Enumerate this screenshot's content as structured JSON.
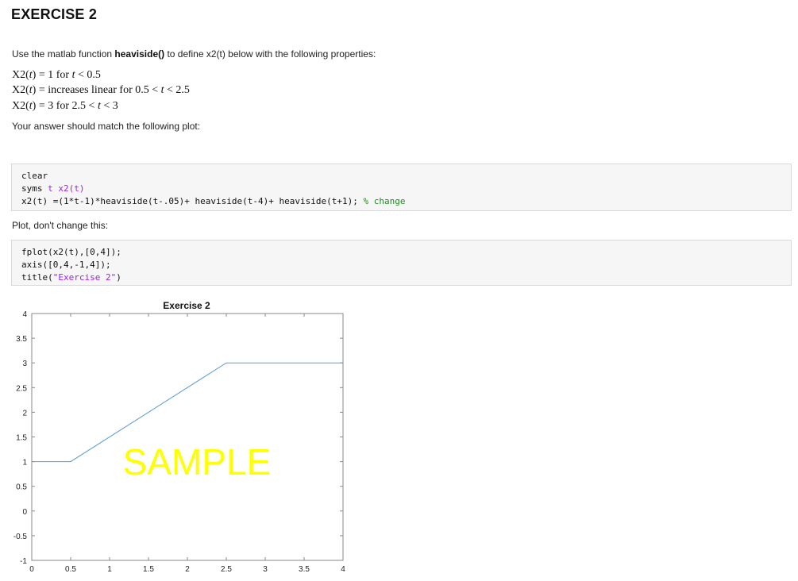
{
  "title": "EXERCISE 2",
  "intro": {
    "prefix": "Use the matlab function",
    "fn": "heaviside()",
    "suffix": "to define x2(t) below with the following properties:"
  },
  "props": {
    "l1": {
      "lhs": "X2(",
      "t": "t",
      "mid": ") = 1 for",
      "cond": " < 0.5"
    },
    "l2": {
      "lhs": "X2(",
      "t": "t",
      "mid": ") = increases linear for 0.5 <",
      "cond": " < 2.5"
    },
    "l3": {
      "lhs": "X2(",
      "t": "t",
      "mid": ") = 3 for 2.5 <",
      "cond": " < 3"
    }
  },
  "note": "Your answer should match the following plot:",
  "code1": {
    "line1": "clear",
    "line2_a": "syms ",
    "line2_b": "t x2(t)",
    "line3_a": "x2(t) =(1*t-1)*heaviside(t-.05)+ heaviside(t-4)+ heaviside(t+1); ",
    "line3_c": "% change"
  },
  "note2": "Plot, don't change this:",
  "code2": {
    "line1": "fplot(x2(t),[0,4]);",
    "line2": "axis([0,4,-1,4]);",
    "line3_a": "title(",
    "line3_b": "\"Exercise 2\"",
    "line3_c": ")"
  },
  "watermark": "SAMPLE",
  "colors": {
    "line": "#5b9bd5",
    "watermark": "#ffff00",
    "comment": "#228b22",
    "string": "#a020f0"
  },
  "chart_data": {
    "type": "line",
    "title": "Exercise 2",
    "x": [
      0,
      0.5,
      2.5,
      4
    ],
    "y": [
      1,
      1,
      3,
      3
    ],
    "xlim": [
      0,
      4
    ],
    "ylim": [
      -1,
      4
    ],
    "xticks": [
      "0",
      "0.5",
      "1",
      "1.5",
      "2",
      "2.5",
      "3",
      "3.5",
      "4"
    ],
    "yticks": [
      "4",
      "3.5",
      "3",
      "2.5",
      "2",
      "1.5",
      "1",
      "0.5",
      "0",
      "-0.5",
      "-1"
    ],
    "grid": false
  }
}
